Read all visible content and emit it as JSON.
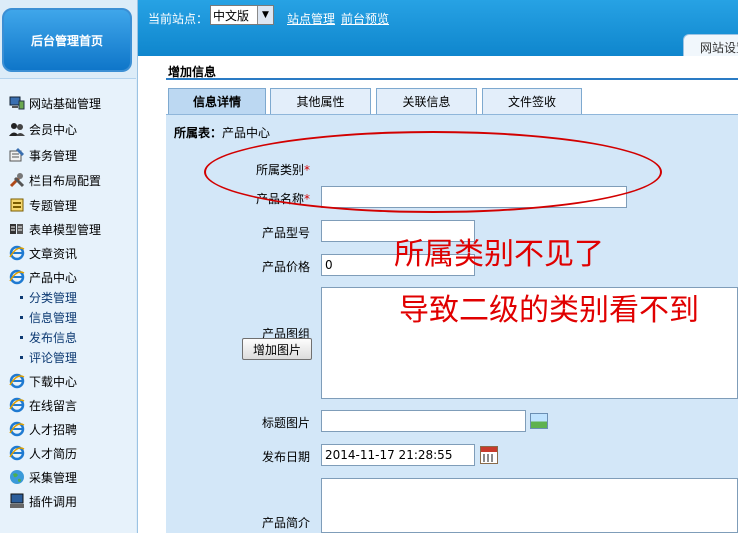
{
  "sidebar": {
    "home_label": "后台管理首页",
    "items": [
      {
        "label": "网站基础管理",
        "icon": "monitor-icon"
      },
      {
        "label": "会员中心",
        "icon": "users-icon"
      },
      {
        "label": "事务管理",
        "icon": "tasks-icon"
      },
      {
        "label": "栏目布局配置",
        "icon": "tools-icon"
      },
      {
        "label": "专题管理",
        "icon": "topics-icon"
      },
      {
        "label": "表单模型管理",
        "icon": "forms-icon"
      },
      {
        "label": "文章资讯",
        "icon": "ie-icon"
      },
      {
        "label": "产品中心",
        "icon": "ie-icon"
      },
      {
        "label": "下载中心",
        "icon": "ie-icon"
      },
      {
        "label": "在线留言",
        "icon": "ie-icon"
      },
      {
        "label": "人才招聘",
        "icon": "ie-icon"
      },
      {
        "label": "人才简历",
        "icon": "ie-icon"
      },
      {
        "label": "采集管理",
        "icon": "globe-icon"
      },
      {
        "label": "插件调用",
        "icon": "computer-icon"
      }
    ],
    "sub_items": [
      "分类管理",
      "信息管理",
      "发布信息",
      "评论管理"
    ]
  },
  "topbar": {
    "site_label": "当前站点：",
    "site_value": "中文版",
    "link_site_mgmt": "站点管理",
    "link_preview": "前台预览",
    "tab_label": "网站设置"
  },
  "page": {
    "title": "增加信息",
    "tabs": [
      "信息详情",
      "其他属性",
      "关联信息",
      "文件签收"
    ],
    "owner_label": "所属表：",
    "owner_value": "产品中心"
  },
  "form": {
    "category_label": "所属类别",
    "name_label": "产品名称",
    "model_label": "产品型号",
    "price_label": "产品价格",
    "price_value": "0",
    "gallery_label": "产品图组",
    "upload_button": "增加图片",
    "title_image_label": "标题图片",
    "date_label": "发布日期",
    "date_value": "2014-11-17 21:28:55",
    "intro_label": "产品简介",
    "required_mark": "*"
  },
  "annotation": {
    "line1": "所属类别不见了",
    "line2": "导致二级的类别看不到"
  },
  "colors": {
    "header_blue": "#1a94d8",
    "sidebar_bg": "#dcecf8",
    "panel_bg": "#d3e7f8",
    "annotation_red": "#e00000"
  }
}
